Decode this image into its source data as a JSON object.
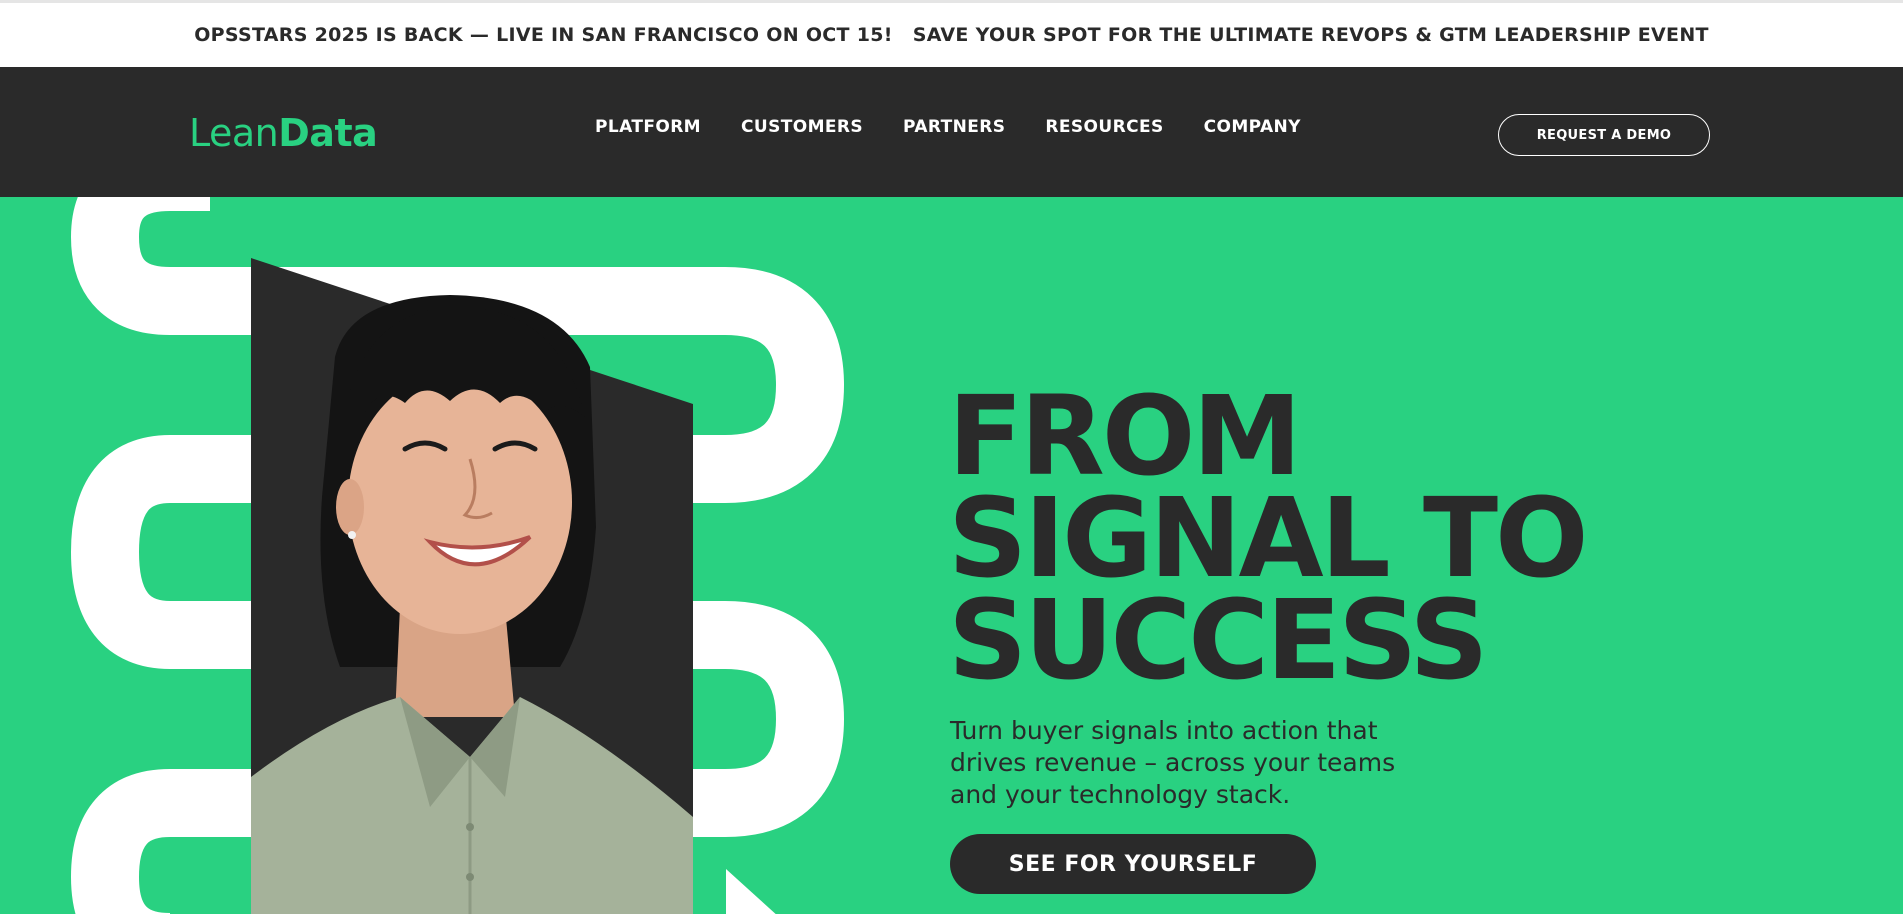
{
  "announcement": {
    "left_text": "OPSSTARS 2025 IS BACK — LIVE IN SAN FRANCISCO ON OCT 15!",
    "right_text": "SAVE YOUR SPOT FOR THE ULTIMATE REVOPS & GTM LEADERSHIP EVENT"
  },
  "header": {
    "logo": {
      "part1": "Lean",
      "part2": "Data"
    },
    "nav": [
      "PLATFORM",
      "CUSTOMERS",
      "PARTNERS",
      "RESOURCES",
      "COMPANY"
    ],
    "cta_label": "REQUEST A DEMO"
  },
  "hero": {
    "headline": [
      "FROM",
      "SIGNAL TO",
      "SUCCESS"
    ],
    "subtext": "Turn buyer signals into action that drives revenue – across your teams and your technology stack.",
    "cta_label": "SEE FOR YOURSELF",
    "image_alt": "Smiling woman looking upward"
  },
  "colors": {
    "brand_green": "#29d181",
    "dark": "#2a2a2a",
    "white": "#ffffff"
  },
  "icons": [
    "leandata-logo",
    "pipeline-path-graphic"
  ]
}
